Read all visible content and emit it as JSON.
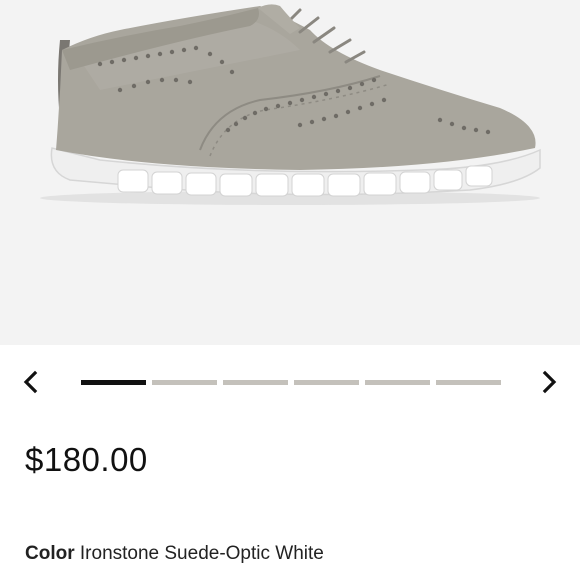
{
  "product": {
    "image_alt": "Gray suede wingtip sneaker with white sole",
    "price": "$180.00",
    "color_label": "Color",
    "color_value": "Ironstone Suede-Optic White"
  },
  "carousel": {
    "prev_icon": "chevron-left-icon",
    "next_icon": "chevron-right-icon",
    "total_slides": 6,
    "active_index": 0
  },
  "colors": {
    "indicator_active": "#111111",
    "indicator_inactive": "#c4c1bb",
    "hero_background": "#f3f3f3",
    "suede": "#a8a59c",
    "sole": "#eeeeee"
  }
}
